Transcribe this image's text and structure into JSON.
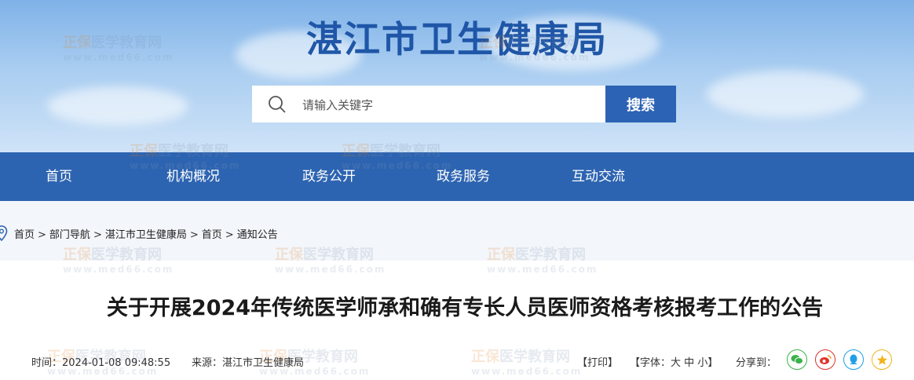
{
  "header": {
    "site_title": "湛江市卫生健康局",
    "search_placeholder": "请输入关键字",
    "search_button": "搜索"
  },
  "nav": {
    "items": [
      {
        "label": "首页"
      },
      {
        "label": "机构概况"
      },
      {
        "label": "政务公开"
      },
      {
        "label": "政务服务"
      },
      {
        "label": "互动交流"
      }
    ]
  },
  "breadcrumb": [
    "首页",
    "部门导航",
    "湛江市卫生健康局",
    "首页",
    "通知公告"
  ],
  "article": {
    "title": "关于开展2024年传统医学师承和确有专长人员医师资格考核报考工作的公告",
    "time_label": "时间：",
    "time_value": "2024-01-08 09:48:55",
    "source_label": "来源：",
    "source_value": "湛江市卫生健康局"
  },
  "tools": {
    "print": "【打印】",
    "font_label": "【字体：",
    "font_large": "大",
    "font_medium": "中",
    "font_small": "小",
    "font_close": "】",
    "share_label": "分享到："
  },
  "share_icons": [
    "wechat-icon",
    "weibo-icon",
    "qq-icon",
    "qzone-icon"
  ],
  "watermark": {
    "brand_a": "正保",
    "brand_b": "医学教育网",
    "url": "www.med66.com"
  },
  "colors": {
    "nav_bg": "#2d64b1",
    "title_blue": "#1f56a7",
    "search_btn": "#2d63b4"
  }
}
